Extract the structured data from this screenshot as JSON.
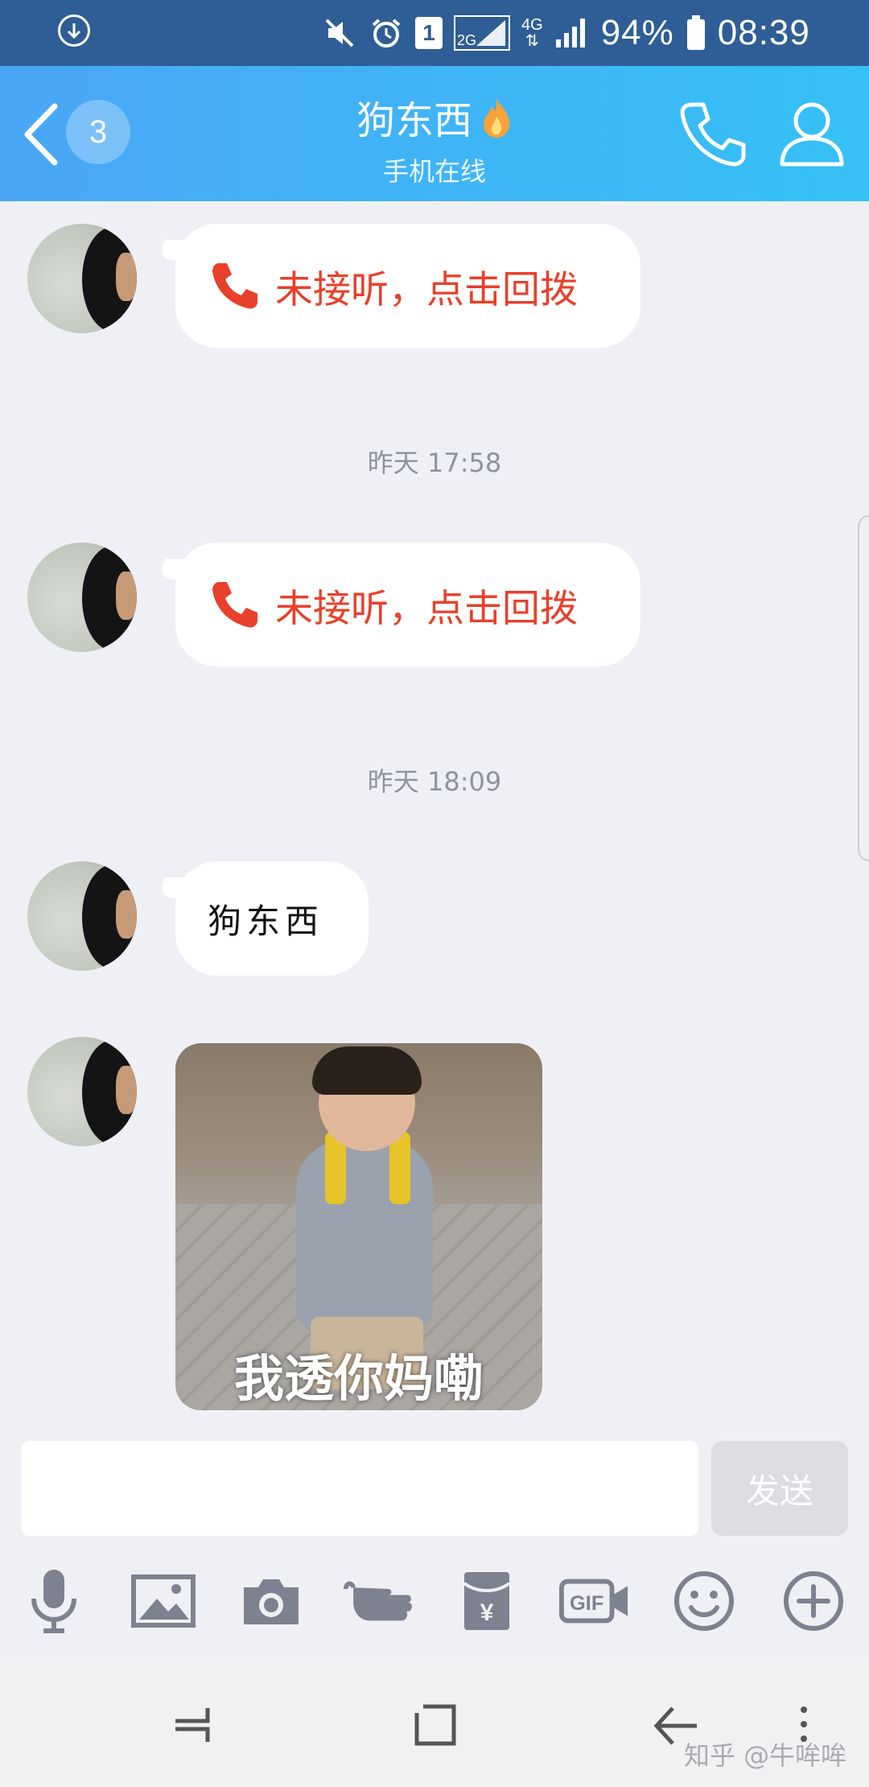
{
  "status_bar": {
    "battery": "94%",
    "time": "08:39",
    "sim_slot": "1",
    "network_2g": "2G",
    "network_4g": "4G"
  },
  "header": {
    "back_badge": "3",
    "contact_name": "狗东西",
    "contact_status": "手机在线"
  },
  "messages": [
    {
      "type": "missed_call",
      "text": "未接听，点击回拨"
    },
    {
      "type": "timestamp",
      "text": "昨天 17:58"
    },
    {
      "type": "missed_call",
      "text": "未接听，点击回拨"
    },
    {
      "type": "timestamp",
      "text": "昨天 18:09"
    },
    {
      "type": "text",
      "text": "狗东西"
    },
    {
      "type": "sticker",
      "caption": "我透你妈嘞"
    }
  ],
  "composer": {
    "input_value": "",
    "send_label": "发送"
  },
  "toolbar": {
    "items": [
      "voice-icon",
      "image-icon",
      "camera-icon",
      "poke-icon",
      "red-packet-icon",
      "gif-icon",
      "emoji-icon",
      "plus-icon"
    ],
    "gif_label": "GIF",
    "red_packet_symbol": "¥"
  },
  "watermark": "知乎 @牛哞哞",
  "colors": {
    "header_start": "#4aa6f6",
    "header_end": "#35c1f6",
    "missed_call": "#e8402a",
    "status_bar": "#2e5e95"
  }
}
